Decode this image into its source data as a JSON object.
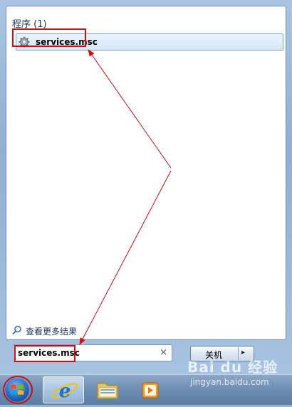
{
  "start_menu": {
    "section_title": "程序 (1)",
    "results": [
      {
        "label": "services.msc",
        "icon": "gear-icon"
      }
    ],
    "more_results_label": "查看更多结果",
    "search": {
      "value": "services.msc",
      "clear_label": "×"
    },
    "shutdown": {
      "label": "关机",
      "arrow": "▸"
    }
  },
  "taskbar": {
    "items": [
      {
        "name": "start-orb",
        "icon": "windows-logo-icon"
      },
      {
        "name": "internet-explorer",
        "icon": "internet-explorer-icon"
      },
      {
        "name": "windows-explorer",
        "icon": "folder-icon"
      },
      {
        "name": "media-player",
        "icon": "media-player-icon"
      }
    ]
  },
  "watermark": {
    "brand": "Bai du 经验",
    "url": "jingyan.baidu.com"
  },
  "colors": {
    "highlight_red": "#d10a0a",
    "panel_blue": "#8fb0d4",
    "selection_blue": "#d6e8fa"
  }
}
